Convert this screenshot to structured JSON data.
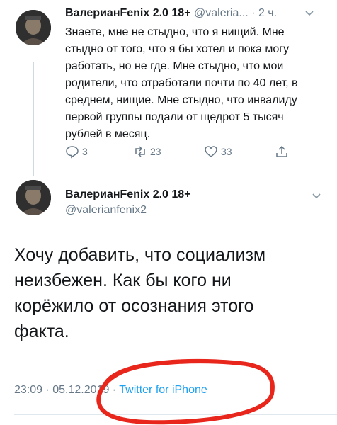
{
  "tweet1": {
    "name": "ВалерианFenix 2.0 18+",
    "handle": "@valeria...",
    "time": "· 2 ч.",
    "text": "Знаете, мне не стыдно, что я нищий. Мне стыдно от того, что я бы хотел и пока могу работать, но не где. Мне стыдно, что мои родители, что отработали почти по 40 лет, в среднем, нищие. Мне стыдно, что инвалиду первой группы подали от щедрот 5 тысяч рублей в месяц.",
    "replies": "3",
    "retweets": "23",
    "likes": "33"
  },
  "tweet2": {
    "name": "ВалерианFenix 2.0 18+",
    "handle": "@valerianfenix2",
    "text": "Хочу добавить, что социализм неизбежен. Как бы кого ни корёжило от осознания этого факта.",
    "datetime": "23:09 · 05.12.2019 ·",
    "source": "Twitter for iPhone"
  },
  "icons": {
    "reply": "reply-icon",
    "retweet": "retweet-icon",
    "like": "heart-icon",
    "share": "share-icon",
    "more": "chevron-down-icon"
  },
  "colors": {
    "text": "#14171a",
    "muted": "#657786",
    "link": "#1da1f2",
    "annotation": "#e8261c"
  }
}
